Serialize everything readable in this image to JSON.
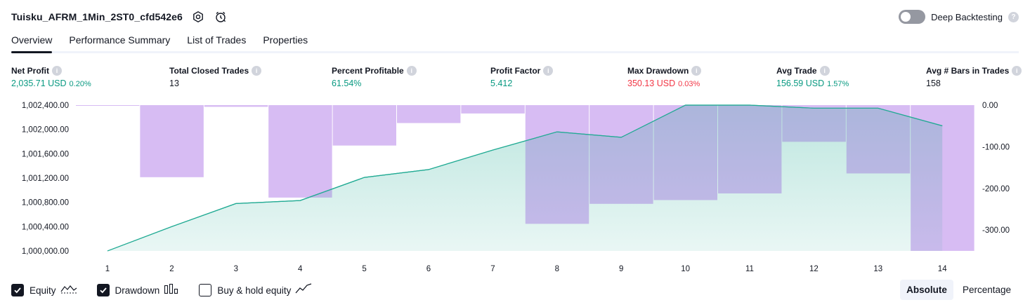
{
  "header": {
    "strategy_name": "Tuisku_AFRM_1Min_2ST0_cfd542e6",
    "deep_backtesting_label": "Deep Backtesting",
    "help_glyph": "?"
  },
  "tabs": [
    {
      "label": "Overview",
      "active": true
    },
    {
      "label": "Performance Summary",
      "active": false
    },
    {
      "label": "List of Trades",
      "active": false
    },
    {
      "label": "Properties",
      "active": false
    }
  ],
  "metrics": [
    {
      "label": "Net Profit",
      "value": "2,035.71 USD",
      "pct": "0.20%",
      "tone": "pos"
    },
    {
      "label": "Total Closed Trades",
      "value": "13",
      "pct": "",
      "tone": "neutral"
    },
    {
      "label": "Percent Profitable",
      "value": "61.54%",
      "pct": "",
      "tone": "pos"
    },
    {
      "label": "Profit Factor",
      "value": "5.412",
      "pct": "",
      "tone": "pos"
    },
    {
      "label": "Max Drawdown",
      "value": "350.13 USD",
      "pct": "0.03%",
      "tone": "neg"
    },
    {
      "label": "Avg Trade",
      "value": "156.59 USD",
      "pct": "1.57%",
      "tone": "pos"
    },
    {
      "label": "Avg # Bars in Trades",
      "value": "158",
      "pct": "",
      "tone": "neutral"
    }
  ],
  "chart_data": {
    "type": "area",
    "x": [
      1,
      2,
      3,
      4,
      5,
      6,
      7,
      8,
      9,
      10,
      11,
      12,
      13,
      14
    ],
    "series": [
      {
        "name": "Equity",
        "chart_type": "area",
        "axis": "left",
        "color": "#22ab94",
        "values": [
          1000000,
          1000400,
          1000780,
          1000830,
          1001210,
          1001340,
          1001660,
          1001960,
          1001870,
          1002400,
          1002400,
          1002350,
          1002350,
          1002060
        ]
      },
      {
        "name": "Drawdown",
        "chart_type": "bar",
        "axis": "right",
        "color": "#ce93d8",
        "values": [
          0,
          -173,
          -4,
          -222,
          -97,
          -43,
          -20,
          -285,
          -237,
          -228,
          -212,
          -88,
          -164,
          -350
        ]
      }
    ],
    "y_left": {
      "ticks": [
        "1,000,000.00",
        "1,000,400.00",
        "1,000,800.00",
        "1,001,200.00",
        "1,001,600.00",
        "1,002,000.00",
        "1,002,400.00"
      ],
      "range": [
        1000000,
        1002400
      ]
    },
    "y_right": {
      "ticks": [
        "0.00",
        "-100.00",
        "-200.00",
        "-300.00"
      ],
      "range": [
        -350.13,
        0
      ]
    },
    "grid": false
  },
  "legend": {
    "equity": {
      "label": "Equity",
      "checked": true,
      "icon": "equity-line-icon"
    },
    "drawdown": {
      "label": "Drawdown",
      "checked": true,
      "icon": "drawdown-bars-icon"
    },
    "buy_hold": {
      "label": "Buy & hold equity",
      "checked": false,
      "icon": "buy-hold-line-icon"
    }
  },
  "mode": {
    "absolute_label": "Absolute",
    "percentage_label": "Percentage",
    "active": "absolute"
  }
}
